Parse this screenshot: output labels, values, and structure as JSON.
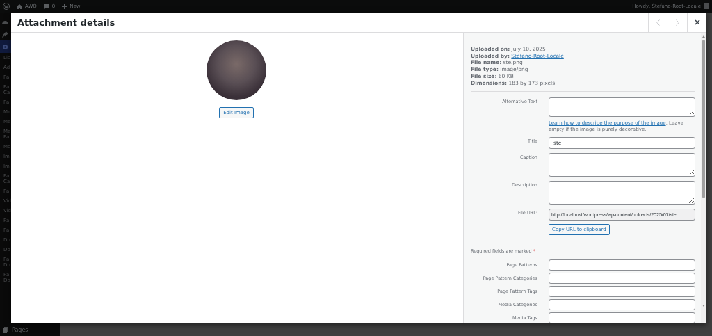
{
  "admin_bar": {
    "site": "AWO",
    "comments": "0",
    "new_label": "New",
    "greeting": "Howdy, Stefano-Root-Locale"
  },
  "admin_menu": {
    "icons": [
      {
        "kind": "dashboard",
        "selected": false
      },
      {
        "kind": "pin",
        "selected": false
      },
      {
        "kind": "settings",
        "selected": true
      }
    ],
    "items": [
      [
        "Lib"
      ],
      [
        "Ad"
      ],
      [
        "Pa"
      ],
      [
        "Pa",
        "Ca"
      ],
      [
        "Pa"
      ],
      [
        "Me"
      ],
      [
        "Me"
      ],
      [
        "Me",
        "Pa"
      ],
      [
        "Mo"
      ],
      [
        "Im"
      ],
      [
        "Im"
      ],
      [
        "Pa",
        "Ca"
      ],
      [
        "Pa"
      ],
      [
        "Vid"
      ],
      [
        "Vid"
      ],
      [
        "Pa"
      ],
      [
        "Pa"
      ],
      [
        "Do"
      ],
      [
        "Do"
      ],
      [
        "Pa",
        "Do"
      ],
      [
        "Pa",
        "Do"
      ]
    ],
    "bottom_item": "Pages"
  },
  "modal": {
    "title": "Attachment details",
    "preview": {
      "edit_button": "Edit Image"
    },
    "details": [
      {
        "label": "Uploaded on:",
        "value": "July 10, 2025",
        "kind": "text"
      },
      {
        "label": "Uploaded by:",
        "value": "Stefano-Root-Locale",
        "kind": "link"
      },
      {
        "label": "File name:",
        "value": "ste.png",
        "kind": "text"
      },
      {
        "label": "File type:",
        "value": "image/png",
        "kind": "text"
      },
      {
        "label": "File size:",
        "value": "60 KB",
        "kind": "text"
      },
      {
        "label": "Dimensions:",
        "value": "183 by 173 pixels",
        "kind": "text"
      }
    ],
    "fields": [
      {
        "label": "Alternative Text",
        "kind": "textarea",
        "help_link": "Learn how to describe the purpose of the image",
        "help_text": ". Leave empty if the image is purely decorative."
      },
      {
        "label": "Title",
        "kind": "input",
        "value": "ste"
      },
      {
        "label": "Caption",
        "kind": "textarea"
      },
      {
        "label": "Description",
        "kind": "textarea"
      },
      {
        "label": "File URL:",
        "kind": "readonly",
        "value": "http://localhost/wordpress/wp-content/uploads/2025/07/ste",
        "button": "Copy URL to clipboard"
      }
    ],
    "required_note": "Required fields are marked",
    "required_mark": "*",
    "taxonomies": [
      {
        "label": "Page Patterns"
      },
      {
        "label": "Page Pattern Categories"
      },
      {
        "label": "Page Pattern Tags"
      },
      {
        "label": "Media Categories"
      },
      {
        "label": "Media Tags"
      }
    ]
  }
}
